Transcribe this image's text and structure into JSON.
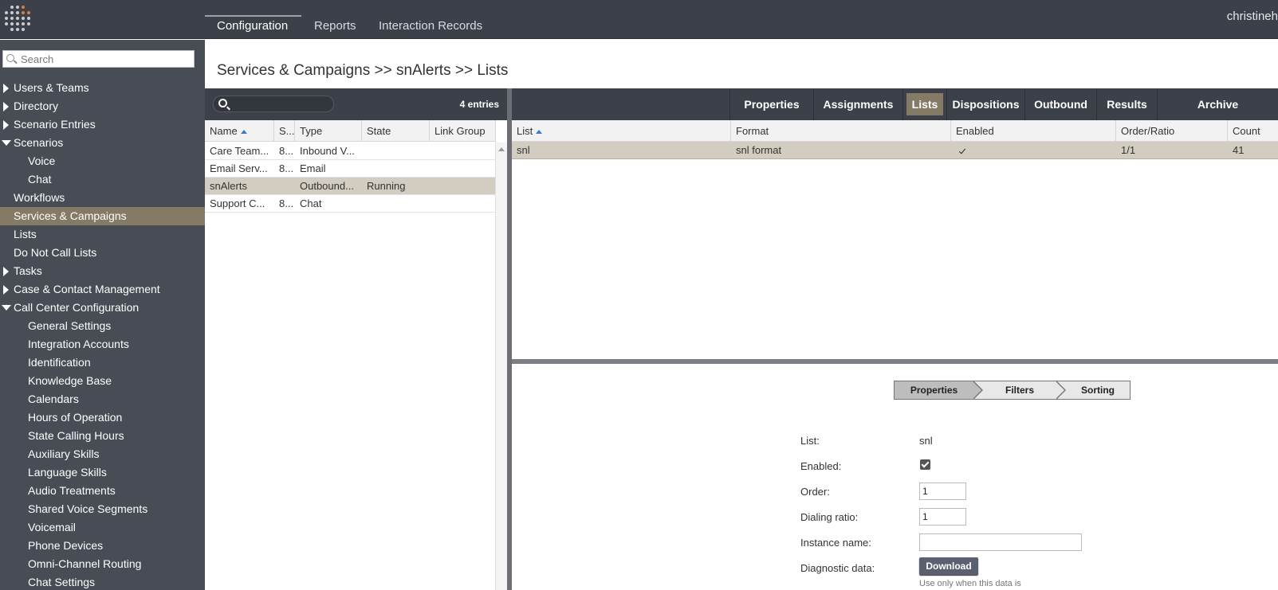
{
  "topnav": {
    "tabs": [
      {
        "label": "Configuration"
      },
      {
        "label": "Reports"
      },
      {
        "label": "Interaction Records"
      }
    ],
    "username": "christineh"
  },
  "sidebar": {
    "search_placeholder": "Search",
    "items": [
      {
        "label": "Users & Teams",
        "level": 0,
        "toggle": "collapsed"
      },
      {
        "label": "Directory",
        "level": 0,
        "toggle": "collapsed"
      },
      {
        "label": "Scenario Entries",
        "level": 0,
        "toggle": "collapsed"
      },
      {
        "label": "Scenarios",
        "level": 0,
        "toggle": "expanded"
      },
      {
        "label": "Voice",
        "level": 1
      },
      {
        "label": "Chat",
        "level": 1
      },
      {
        "label": "Workflows",
        "level": 0
      },
      {
        "label": "Services & Campaigns",
        "level": 0,
        "active": true
      },
      {
        "label": "Lists",
        "level": 0
      },
      {
        "label": "Do Not Call Lists",
        "level": 0
      },
      {
        "label": "Tasks",
        "level": 0,
        "toggle": "collapsed"
      },
      {
        "label": "Case & Contact Management",
        "level": 0,
        "toggle": "collapsed"
      },
      {
        "label": "Call Center Configuration",
        "level": 0,
        "toggle": "expanded"
      },
      {
        "label": "General Settings",
        "level": 1
      },
      {
        "label": "Integration Accounts",
        "level": 1
      },
      {
        "label": "Identification",
        "level": 1
      },
      {
        "label": "Knowledge Base",
        "level": 1
      },
      {
        "label": "Calendars",
        "level": 1
      },
      {
        "label": "Hours of Operation",
        "level": 1
      },
      {
        "label": "State Calling Hours",
        "level": 1
      },
      {
        "label": "Auxiliary Skills",
        "level": 1
      },
      {
        "label": "Language Skills",
        "level": 1
      },
      {
        "label": "Audio Treatments",
        "level": 1
      },
      {
        "label": "Shared Voice Segments",
        "level": 1
      },
      {
        "label": "Voicemail",
        "level": 1
      },
      {
        "label": "Phone Devices",
        "level": 1
      },
      {
        "label": "Omni-Channel Routing",
        "level": 1
      },
      {
        "label": "Chat Settings",
        "level": 1
      }
    ]
  },
  "breadcrumb": "Services & Campaigns >> snAlerts >> Lists",
  "services": {
    "entries": "4 entries",
    "columns": [
      "Name",
      "S...",
      "Type",
      "State",
      "Link Group"
    ],
    "rows": [
      {
        "name": "Care Team...",
        "s": "8...",
        "type": "Inbound V...",
        "state": "",
        "link": ""
      },
      {
        "name": "Email Serv...",
        "s": "8...",
        "type": "Email",
        "state": "",
        "link": ""
      },
      {
        "name": "snAlerts",
        "s": "",
        "type": "Outbound...",
        "state": "Running",
        "link": "",
        "selected": true
      },
      {
        "name": "Support C...",
        "s": "8...",
        "type": "Chat",
        "state": "",
        "link": ""
      }
    ]
  },
  "detail_tabs": [
    "Properties",
    "Assignments",
    "Lists",
    "Dispositions",
    "Outbound",
    "Results",
    "Archive"
  ],
  "active_detail_tab": "Lists",
  "lists_table": {
    "columns": [
      "List",
      "Format",
      "Enabled",
      "Order/Ratio",
      "Count"
    ],
    "rows": [
      {
        "list": "snl",
        "format": "snl format",
        "enabled": true,
        "order_ratio": "1/1",
        "count": "41"
      }
    ]
  },
  "wizard": {
    "steps": [
      "Properties",
      "Filters",
      "Sorting"
    ],
    "active": "Properties"
  },
  "form": {
    "list_label": "List:",
    "list_value": "snl",
    "enabled_label": "Enabled:",
    "enabled": true,
    "order_label": "Order:",
    "order_value": "1",
    "ratio_label": "Dialing ratio:",
    "ratio_value": "1",
    "instance_label": "Instance name:",
    "instance_value": "",
    "diag_label": "Diagnostic data:",
    "download_label": "Download",
    "diag_note": "Use only when this data is"
  }
}
